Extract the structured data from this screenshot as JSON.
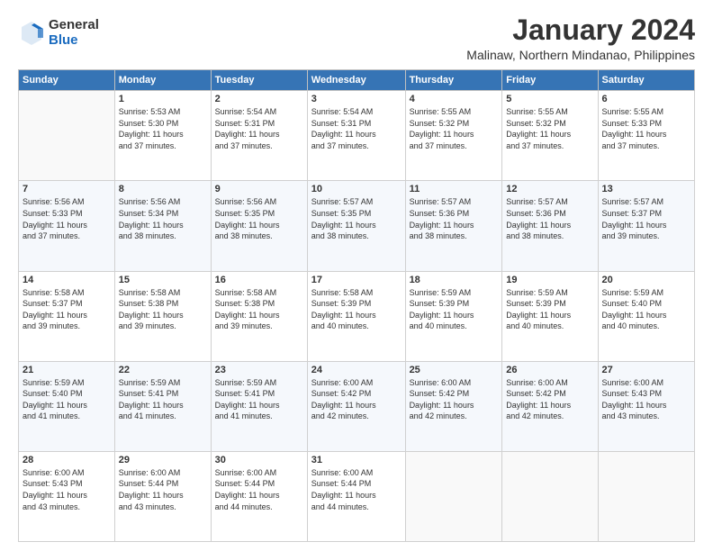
{
  "logo": {
    "general": "General",
    "blue": "Blue"
  },
  "header": {
    "title": "January 2024",
    "location": "Malinaw, Northern Mindanao, Philippines"
  },
  "weekdays": [
    "Sunday",
    "Monday",
    "Tuesday",
    "Wednesday",
    "Thursday",
    "Friday",
    "Saturday"
  ],
  "weeks": [
    [
      {
        "day": "",
        "info": ""
      },
      {
        "day": "1",
        "info": "Sunrise: 5:53 AM\nSunset: 5:30 PM\nDaylight: 11 hours\nand 37 minutes."
      },
      {
        "day": "2",
        "info": "Sunrise: 5:54 AM\nSunset: 5:31 PM\nDaylight: 11 hours\nand 37 minutes."
      },
      {
        "day": "3",
        "info": "Sunrise: 5:54 AM\nSunset: 5:31 PM\nDaylight: 11 hours\nand 37 minutes."
      },
      {
        "day": "4",
        "info": "Sunrise: 5:55 AM\nSunset: 5:32 PM\nDaylight: 11 hours\nand 37 minutes."
      },
      {
        "day": "5",
        "info": "Sunrise: 5:55 AM\nSunset: 5:32 PM\nDaylight: 11 hours\nand 37 minutes."
      },
      {
        "day": "6",
        "info": "Sunrise: 5:55 AM\nSunset: 5:33 PM\nDaylight: 11 hours\nand 37 minutes."
      }
    ],
    [
      {
        "day": "7",
        "info": "Sunrise: 5:56 AM\nSunset: 5:33 PM\nDaylight: 11 hours\nand 37 minutes."
      },
      {
        "day": "8",
        "info": "Sunrise: 5:56 AM\nSunset: 5:34 PM\nDaylight: 11 hours\nand 38 minutes."
      },
      {
        "day": "9",
        "info": "Sunrise: 5:56 AM\nSunset: 5:35 PM\nDaylight: 11 hours\nand 38 minutes."
      },
      {
        "day": "10",
        "info": "Sunrise: 5:57 AM\nSunset: 5:35 PM\nDaylight: 11 hours\nand 38 minutes."
      },
      {
        "day": "11",
        "info": "Sunrise: 5:57 AM\nSunset: 5:36 PM\nDaylight: 11 hours\nand 38 minutes."
      },
      {
        "day": "12",
        "info": "Sunrise: 5:57 AM\nSunset: 5:36 PM\nDaylight: 11 hours\nand 38 minutes."
      },
      {
        "day": "13",
        "info": "Sunrise: 5:57 AM\nSunset: 5:37 PM\nDaylight: 11 hours\nand 39 minutes."
      }
    ],
    [
      {
        "day": "14",
        "info": "Sunrise: 5:58 AM\nSunset: 5:37 PM\nDaylight: 11 hours\nand 39 minutes."
      },
      {
        "day": "15",
        "info": "Sunrise: 5:58 AM\nSunset: 5:38 PM\nDaylight: 11 hours\nand 39 minutes."
      },
      {
        "day": "16",
        "info": "Sunrise: 5:58 AM\nSunset: 5:38 PM\nDaylight: 11 hours\nand 39 minutes."
      },
      {
        "day": "17",
        "info": "Sunrise: 5:58 AM\nSunset: 5:39 PM\nDaylight: 11 hours\nand 40 minutes."
      },
      {
        "day": "18",
        "info": "Sunrise: 5:59 AM\nSunset: 5:39 PM\nDaylight: 11 hours\nand 40 minutes."
      },
      {
        "day": "19",
        "info": "Sunrise: 5:59 AM\nSunset: 5:39 PM\nDaylight: 11 hours\nand 40 minutes."
      },
      {
        "day": "20",
        "info": "Sunrise: 5:59 AM\nSunset: 5:40 PM\nDaylight: 11 hours\nand 40 minutes."
      }
    ],
    [
      {
        "day": "21",
        "info": "Sunrise: 5:59 AM\nSunset: 5:40 PM\nDaylight: 11 hours\nand 41 minutes."
      },
      {
        "day": "22",
        "info": "Sunrise: 5:59 AM\nSunset: 5:41 PM\nDaylight: 11 hours\nand 41 minutes."
      },
      {
        "day": "23",
        "info": "Sunrise: 5:59 AM\nSunset: 5:41 PM\nDaylight: 11 hours\nand 41 minutes."
      },
      {
        "day": "24",
        "info": "Sunrise: 6:00 AM\nSunset: 5:42 PM\nDaylight: 11 hours\nand 42 minutes."
      },
      {
        "day": "25",
        "info": "Sunrise: 6:00 AM\nSunset: 5:42 PM\nDaylight: 11 hours\nand 42 minutes."
      },
      {
        "day": "26",
        "info": "Sunrise: 6:00 AM\nSunset: 5:42 PM\nDaylight: 11 hours\nand 42 minutes."
      },
      {
        "day": "27",
        "info": "Sunrise: 6:00 AM\nSunset: 5:43 PM\nDaylight: 11 hours\nand 43 minutes."
      }
    ],
    [
      {
        "day": "28",
        "info": "Sunrise: 6:00 AM\nSunset: 5:43 PM\nDaylight: 11 hours\nand 43 minutes."
      },
      {
        "day": "29",
        "info": "Sunrise: 6:00 AM\nSunset: 5:44 PM\nDaylight: 11 hours\nand 43 minutes."
      },
      {
        "day": "30",
        "info": "Sunrise: 6:00 AM\nSunset: 5:44 PM\nDaylight: 11 hours\nand 44 minutes."
      },
      {
        "day": "31",
        "info": "Sunrise: 6:00 AM\nSunset: 5:44 PM\nDaylight: 11 hours\nand 44 minutes."
      },
      {
        "day": "",
        "info": ""
      },
      {
        "day": "",
        "info": ""
      },
      {
        "day": "",
        "info": ""
      }
    ]
  ]
}
